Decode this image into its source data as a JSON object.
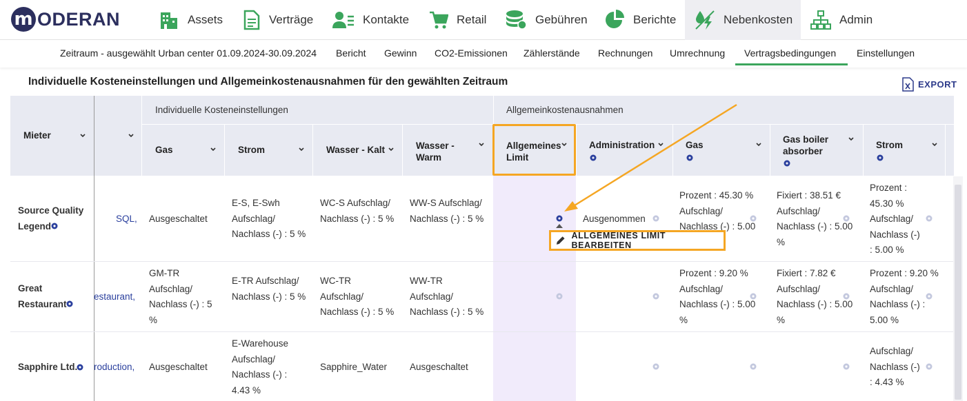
{
  "brand": {
    "logo_letter": "m",
    "logo_text": "ODERAN"
  },
  "nav": [
    {
      "label": "Assets",
      "icon": "building-icon"
    },
    {
      "label": "Verträge",
      "icon": "document-icon"
    },
    {
      "label": "Kontakte",
      "icon": "contacts-icon"
    },
    {
      "label": "Retail",
      "icon": "cart-icon"
    },
    {
      "label": "Gebühren",
      "icon": "coins-icon"
    },
    {
      "label": "Berichte",
      "icon": "pie-chart-icon"
    },
    {
      "label": "Nebenkosten",
      "icon": "utilities-icon",
      "active": true
    },
    {
      "label": "Admin",
      "icon": "org-chart-icon"
    }
  ],
  "subnav": {
    "period": "Zeitraum - ausgewählt Urban center 01.09.2024-30.09.2024",
    "items": [
      "Bericht",
      "Gewinn",
      "CO2-Emissionen",
      "Zählerstände",
      "Rechnungen",
      "Umrechnung",
      "Vertragsbedingungen",
      "Einstellungen"
    ],
    "active": "Vertragsbedingungen"
  },
  "page": {
    "title": "Individuelle Kosteneinstellungen und Allgemeinkostenausnahmen für den gewählten Zeitraum",
    "export_label": "EXPORT"
  },
  "table": {
    "col_mieter": "Mieter",
    "group_individual": "Individuelle Kosteneinstellungen",
    "group_general": "Allgemeinkostenausnahmen",
    "cols_individual": [
      "Gas",
      "Strom",
      "Wasser - Kalt",
      "Wasser - Warm"
    ],
    "cols_general": [
      "Allgemeines Limit",
      "Administration",
      "Gas",
      "Gas boiler absorber",
      "Strom"
    ],
    "rows": [
      {
        "tenant": "Source Quality Legend",
        "short": "SQL,",
        "gas": "Ausgeschaltet",
        "strom": "E-S, E-Swh Aufschlag/ Nachlass (-) : 5 %",
        "wk": "WC-S Aufschlag/ Nachlass (-) : 5 %",
        "ww": "WW-S Aufschlag/ Nachlass (-) : 5 %",
        "limit": "",
        "admin": "Ausgenommen",
        "g_gas": "Prozent : 45.30 % Aufschlag/ Nachlass (-) : 5.00",
        "g_boiler": "Fixiert : 38.51 € Aufschlag/ Nachlass (-) : 5.00 %",
        "g_strom": "Prozent : 45.30 % Aufschlag/ Nachlass (-) : 5.00 %"
      },
      {
        "tenant": "Great Restaurant",
        "short": "estaurant,",
        "gas": "GM-TR Aufschlag/ Nachlass (-) : 5 %",
        "strom": "E-TR Aufschlag/ Nachlass (-) : 5 %",
        "wk": "WC-TR Aufschlag/ Nachlass (-) : 5 %",
        "ww": "WW-TR Aufschlag/ Nachlass (-) : 5 %",
        "limit": "",
        "admin": "",
        "g_gas": "Prozent : 9.20 % Aufschlag/ Nachlass (-) : 5.00 %",
        "g_boiler": "Fixiert : 7.82 € Aufschlag/ Nachlass (-) : 5.00 %",
        "g_strom": "Prozent : 9.20 % Aufschlag/ Nachlass (-) : 5.00 %"
      },
      {
        "tenant": "Sapphire Ltd.",
        "short": "roduction,",
        "gas": "Ausgeschaltet",
        "strom": "E-Warehouse Aufschlag/ Nachlass (-) : 4.43 %",
        "wk": "Sapphire_Water",
        "ww": "Ausgeschaltet",
        "limit": "",
        "admin": "",
        "g_gas": "",
        "g_boiler": "",
        "g_strom": "Aufschlag/ Nachlass (-) : 4.43 %"
      }
    ]
  },
  "tooltip": {
    "label": "ALLGEMEINES LIMIT BEARBEITEN"
  },
  "colors": {
    "accent": "#f5a623",
    "active_tab": "#3ba55c",
    "brand": "#2c2f5e",
    "icon_green": "#3ba55c",
    "gear": "#9aa3c4"
  }
}
